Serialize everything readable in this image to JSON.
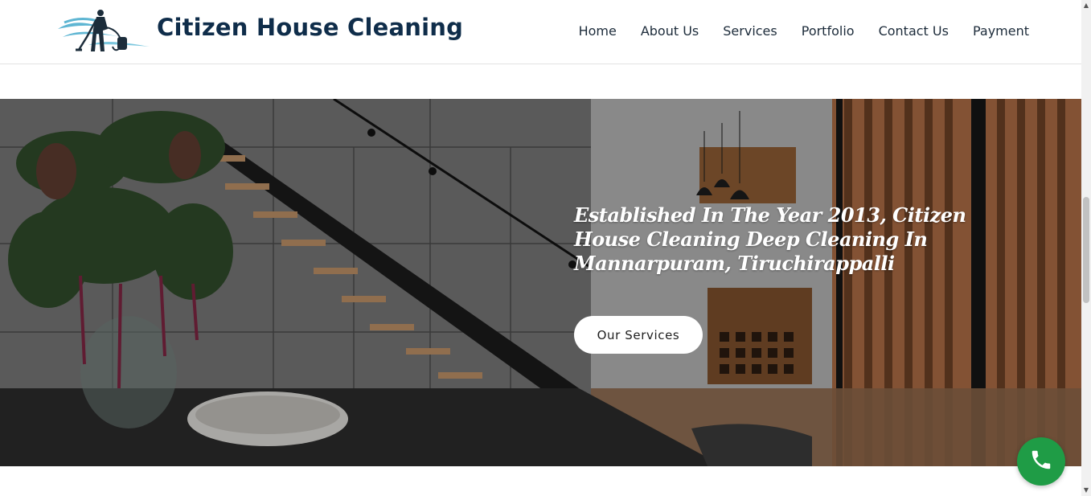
{
  "header": {
    "brand_name": "Citizen House Cleaning",
    "logo_icon": "cleaner-vacuum-logo-icon",
    "nav": [
      {
        "label": "Home"
      },
      {
        "label": "About Us"
      },
      {
        "label": "Services"
      },
      {
        "label": "Portfolio"
      },
      {
        "label": "Contact Us"
      },
      {
        "label": "Payment"
      }
    ]
  },
  "hero": {
    "title": "Established In The Year 2013, Citizen House Cleaning Deep Cleaning In Mannarpuram, Tiruchirappalli",
    "button_label": "Our Services"
  },
  "floating": {
    "phone_icon": "phone-icon",
    "phone_color": "#1f9c46"
  },
  "colors": {
    "brand": "#0f2d4a",
    "nav_text": "#1c2b3a"
  }
}
